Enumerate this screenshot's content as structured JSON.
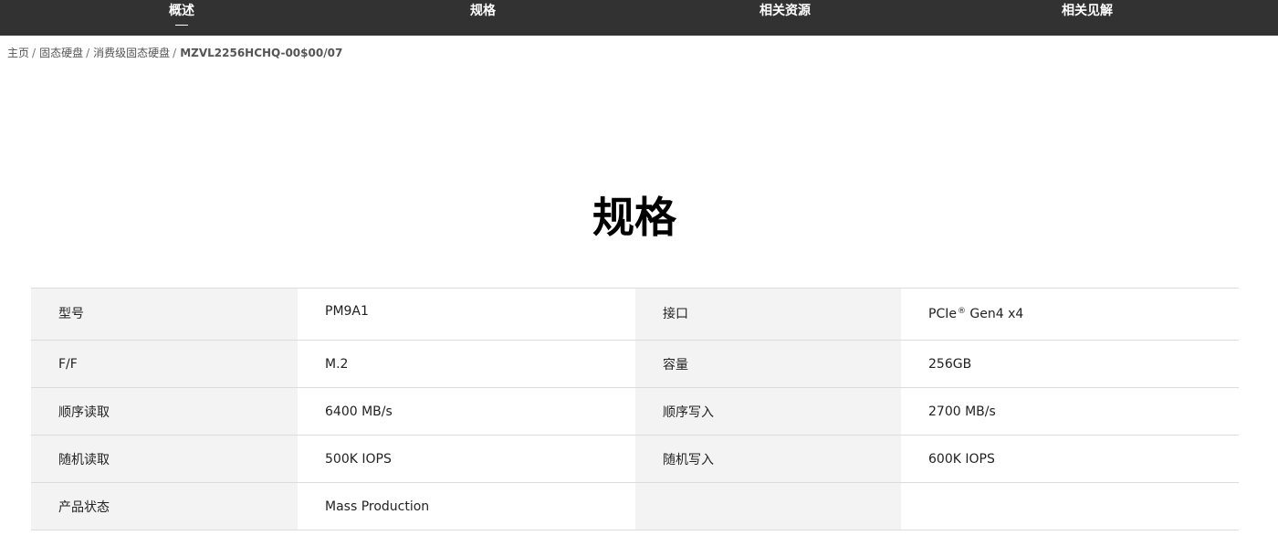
{
  "nav": {
    "items": [
      "概述",
      "规格",
      "相关资源",
      "相关见解"
    ],
    "active_index": 0
  },
  "breadcrumb": {
    "items": [
      "主页",
      "固态硬盘",
      "消费级固态硬盘"
    ],
    "separator": "/",
    "current": "MZVL2256HCHQ-00$00/07"
  },
  "page": {
    "title": "规格"
  },
  "specs": {
    "rows": [
      {
        "label1": "型号",
        "value1": "PM9A1",
        "label2": "接口",
        "value2_prefix": "PCIe",
        "value2_sup": "®",
        "value2_suffix": " Gen4 x4"
      },
      {
        "label1": "F/F",
        "value1": "M.2",
        "label2": "容量",
        "value2": "256GB"
      },
      {
        "label1": "顺序读取",
        "value1": "6400 MB/s",
        "label2": "顺序写入",
        "value2": "2700 MB/s"
      },
      {
        "label1": "随机读取",
        "value1": "500K IOPS",
        "label2": "随机写入",
        "value2": "600K IOPS"
      },
      {
        "label1": "产品状态",
        "value1": "Mass Production",
        "label2": "",
        "value2": ""
      }
    ]
  },
  "colors": {
    "nav_background": "#323232",
    "label_cell_background": "#f3f3f3",
    "row_divider": "#dcdcdc"
  }
}
